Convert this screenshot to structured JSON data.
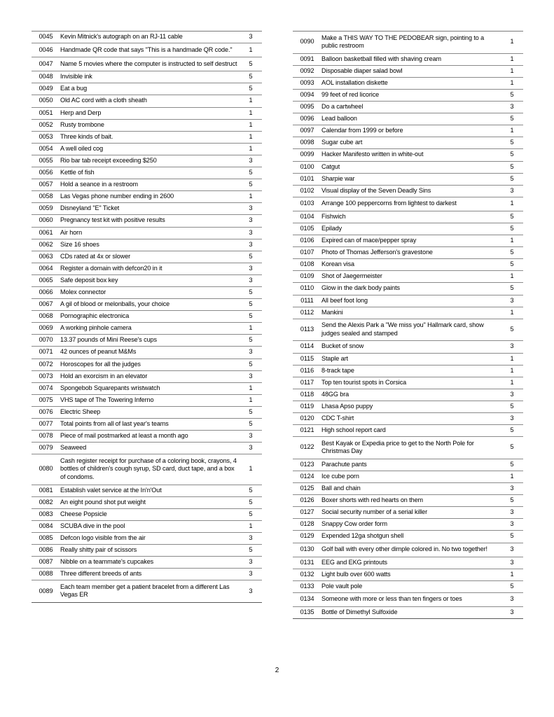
{
  "document": {
    "page_number": "2",
    "columns": [
      {
        "name": "left-column",
        "rows": [
          {
            "id": "0045",
            "description": "Kevin Mitnick's autograph on an RJ-11 cable",
            "score": "3"
          },
          {
            "id": "0046",
            "description": "Handmade QR code that says \"This is a handmade QR code.\"",
            "score": "1"
          },
          {
            "id": "0047",
            "description": "Name 5 movies where the computer is instructed to self destruct",
            "score": "5"
          },
          {
            "id": "0048",
            "description": "Invisible ink",
            "score": "5"
          },
          {
            "id": "0049",
            "description": "Eat a bug",
            "score": "5"
          },
          {
            "id": "0050",
            "description": "Old AC cord with a cloth sheath",
            "score": "1"
          },
          {
            "id": "0051",
            "description": "Herp and Derp",
            "score": "1"
          },
          {
            "id": "0052",
            "description": "Rusty trombone",
            "score": "1"
          },
          {
            "id": "0053",
            "description": "Three kinds of bait.",
            "score": "1"
          },
          {
            "id": "0054",
            "description": "A well oiled cog",
            "score": "1"
          },
          {
            "id": "0055",
            "description": "Rio bar tab receipt exceeding $250",
            "score": "3"
          },
          {
            "id": "0056",
            "description": "Kettle of fish",
            "score": "5"
          },
          {
            "id": "0057",
            "description": "Hold a seance in a restroom",
            "score": "5"
          },
          {
            "id": "0058",
            "description": "Las Vegas phone number ending in 2600",
            "score": "1"
          },
          {
            "id": "0059",
            "description": "Disneyland \"E\" Ticket",
            "score": "3"
          },
          {
            "id": "0060",
            "description": "Pregnancy test kit with positive results",
            "score": "3"
          },
          {
            "id": "0061",
            "description": "Air horn",
            "score": "3"
          },
          {
            "id": "0062",
            "description": "Size 16 shoes",
            "score": "3"
          },
          {
            "id": "0063",
            "description": "CDs rated at 4x or slower",
            "score": "5"
          },
          {
            "id": "0064",
            "description": "Register a domain with defcon20 in it",
            "score": "3"
          },
          {
            "id": "0065",
            "description": "Safe deposit box key",
            "score": "3"
          },
          {
            "id": "0066",
            "description": "Molex connector",
            "score": "5"
          },
          {
            "id": "0067",
            "description": "A gil of blood or melonballs, your choice",
            "score": "5"
          },
          {
            "id": "0068",
            "description": "Pornographic electronica",
            "score": "5"
          },
          {
            "id": "0069",
            "description": "A working pinhole camera",
            "score": "1"
          },
          {
            "id": "0070",
            "description": "13.37 pounds of Mini Reese's cups",
            "score": "5"
          },
          {
            "id": "0071",
            "description": "42 ounces of peanut M&Ms",
            "score": "3"
          },
          {
            "id": "0072",
            "description": "Horoscopes for all the judges",
            "score": "5"
          },
          {
            "id": "0073",
            "description": "Hold an exorcism in an elevator",
            "score": "3"
          },
          {
            "id": "0074",
            "description": "Spongebob Squarepants wristwatch",
            "score": "1"
          },
          {
            "id": "0075",
            "description": "VHS tape of The Towering Inferno",
            "score": "1"
          },
          {
            "id": "0076",
            "description": "Electric Sheep",
            "score": "5"
          },
          {
            "id": "0077",
            "description": "Total points from all of last year's teams",
            "score": "5"
          },
          {
            "id": "0078",
            "description": "Piece of mail postmarked at least a month ago",
            "score": "3"
          },
          {
            "id": "0079",
            "description": "Seaweed",
            "score": "3"
          },
          {
            "id": "0080",
            "description": "Cash register receipt for purchase of a coloring book, crayons, 4 bottles of children's cough syrup, SD card, duct tape, and a box of condoms.",
            "score": "1"
          },
          {
            "id": "0081",
            "description": "Establish valet service at the In'n'Out",
            "score": "5"
          },
          {
            "id": "0082",
            "description": "An eight pound shot put weight",
            "score": "5"
          },
          {
            "id": "0083",
            "description": "Cheese Popsicle",
            "score": "5"
          },
          {
            "id": "0084",
            "description": "SCUBA dive in the pool",
            "score": "1"
          },
          {
            "id": "0085",
            "description": "Defcon logo visible from the air",
            "score": "3"
          },
          {
            "id": "0086",
            "description": "Really shitty pair of scissors",
            "score": "5"
          },
          {
            "id": "0087",
            "description": "Nibble on a teammate's cupcakes",
            "score": "3"
          },
          {
            "id": "0088",
            "description": "Three different breeds of ants",
            "score": "3"
          },
          {
            "id": "0089",
            "description": "Each team member get a patient bracelet from a different Las Vegas ER",
            "score": "3"
          }
        ]
      },
      {
        "name": "right-column",
        "rows": [
          {
            "id": "0090",
            "description": "Make a THIS WAY TO THE PEDOBEAR sign, pointing to a public restroom",
            "score": "1"
          },
          {
            "id": "0091",
            "description": "Balloon basketball filled with shaving cream",
            "score": "1"
          },
          {
            "id": "0092",
            "description": "Disposable diaper salad bowl",
            "score": "1"
          },
          {
            "id": "0093",
            "description": "AOL installation diskette",
            "score": "1"
          },
          {
            "id": "0094",
            "description": "99 feet of red licorice",
            "score": "5"
          },
          {
            "id": "0095",
            "description": "Do a cartwheel",
            "score": "3"
          },
          {
            "id": "0096",
            "description": "Lead balloon",
            "score": "5"
          },
          {
            "id": "0097",
            "description": "Calendar from 1999 or before",
            "score": "1"
          },
          {
            "id": "0098",
            "description": "Sugar cube art",
            "score": "5"
          },
          {
            "id": "0099",
            "description": "Hacker Manifesto written in white-out",
            "score": "5"
          },
          {
            "id": "0100",
            "description": "Catgut",
            "score": "5"
          },
          {
            "id": "0101",
            "description": "Sharpie war",
            "score": "5"
          },
          {
            "id": "0102",
            "description": "Visual display of the Seven Deadly Sins",
            "score": "3"
          },
          {
            "id": "0103",
            "description": "Arrange 100 peppercorns from lightest to darkest",
            "score": "1"
          },
          {
            "id": "0104",
            "description": "Fishwich",
            "score": "5"
          },
          {
            "id": "0105",
            "description": "Epilady",
            "score": "5"
          },
          {
            "id": "0106",
            "description": "Expired can of mace/pepper spray",
            "score": "1"
          },
          {
            "id": "0107",
            "description": "Photo of Thomas Jefferson's gravestone",
            "score": "5"
          },
          {
            "id": "0108",
            "description": "Korean visa",
            "score": "5"
          },
          {
            "id": "0109",
            "description": "Shot of Jaegermeister",
            "score": "1"
          },
          {
            "id": "0110",
            "description": "Glow in the dark body paints",
            "score": "5"
          },
          {
            "id": "0111",
            "description": "All beef foot long",
            "score": "3"
          },
          {
            "id": "0112",
            "description": "Mankini",
            "score": "1"
          },
          {
            "id": "0113",
            "description": "Send the Alexis Park a \"We miss you\" Hallmark card, show judges sealed and stamped",
            "score": "5"
          },
          {
            "id": "0114",
            "description": "Bucket of snow",
            "score": "3"
          },
          {
            "id": "0115",
            "description": "Staple art",
            "score": "1"
          },
          {
            "id": "0116",
            "description": "8-track tape",
            "score": "1"
          },
          {
            "id": "0117",
            "description": "Top ten tourist spots in Corsica",
            "score": "1"
          },
          {
            "id": "0118",
            "description": "48GG bra",
            "score": "3"
          },
          {
            "id": "0119",
            "description": "Lhasa Apso puppy",
            "score": "5"
          },
          {
            "id": "0120",
            "description": "CDC T-shirt",
            "score": "3"
          },
          {
            "id": "0121",
            "description": "High school report card",
            "score": "5"
          },
          {
            "id": "0122",
            "description": "Best Kayak or Expedia price to get to the North Pole for Christmas Day",
            "score": "5"
          },
          {
            "id": "0123",
            "description": "Parachute pants",
            "score": "5"
          },
          {
            "id": "0124",
            "description": "Ice cube porn",
            "score": "1"
          },
          {
            "id": "0125",
            "description": "Ball and chain",
            "score": "3"
          },
          {
            "id": "0126",
            "description": "Boxer shorts with red hearts on them",
            "score": "5"
          },
          {
            "id": "0127",
            "description": "Social security number of a serial killer",
            "score": "3"
          },
          {
            "id": "0128",
            "description": "Snappy Cow order form",
            "score": "3"
          },
          {
            "id": "0129",
            "description": "Expended 12ga shotgun shell",
            "score": "5"
          },
          {
            "id": "0130",
            "description": "Golf ball with every other dimple colored in. No two together!",
            "score": "3"
          },
          {
            "id": "0131",
            "description": "EEG and EKG printouts",
            "score": "3"
          },
          {
            "id": "0132",
            "description": "Light bulb over 600 watts",
            "score": "1"
          },
          {
            "id": "0133",
            "description": "Pole vault pole",
            "score": "5"
          },
          {
            "id": "0134",
            "description": "Someone with more or less than ten fingers or toes",
            "score": "3"
          },
          {
            "id": "0135",
            "description": "Bottle of Dimethyl Sulfoxide",
            "score": "3"
          }
        ]
      }
    ]
  }
}
